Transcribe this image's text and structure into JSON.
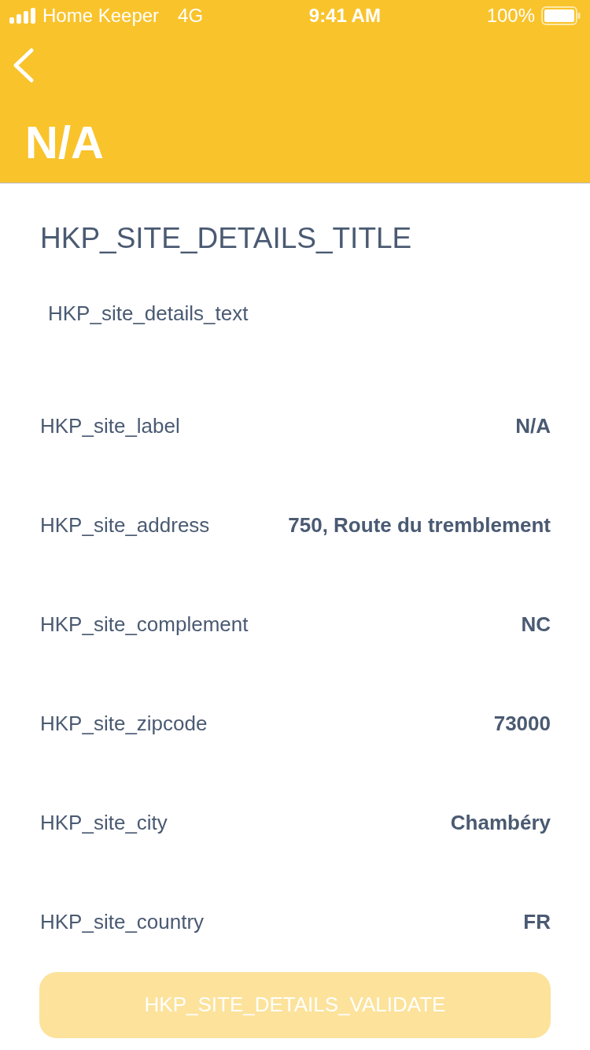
{
  "status_bar": {
    "carrier": "Home Keeper",
    "network": "4G",
    "time": "9:41 AM",
    "battery": "100%"
  },
  "header": {
    "title": "N/A"
  },
  "intro": {
    "title": "HKP_SITE_DETAILS_TITLE",
    "text": "HKP_site_details_text"
  },
  "details": [
    {
      "label": "HKP_site_label",
      "value": "N/A"
    },
    {
      "label": "HKP_site_address",
      "value": "750, Route du tremblement"
    },
    {
      "label": "HKP_site_complement",
      "value": "NC"
    },
    {
      "label": "HKP_site_zipcode",
      "value": "73000"
    },
    {
      "label": "HKP_site_city",
      "value": "Chambéry"
    },
    {
      "label": "HKP_site_country",
      "value": "FR"
    }
  ],
  "button": {
    "label": "HKP_SITE_DETAILS_VALIDATE",
    "disabled": true
  }
}
